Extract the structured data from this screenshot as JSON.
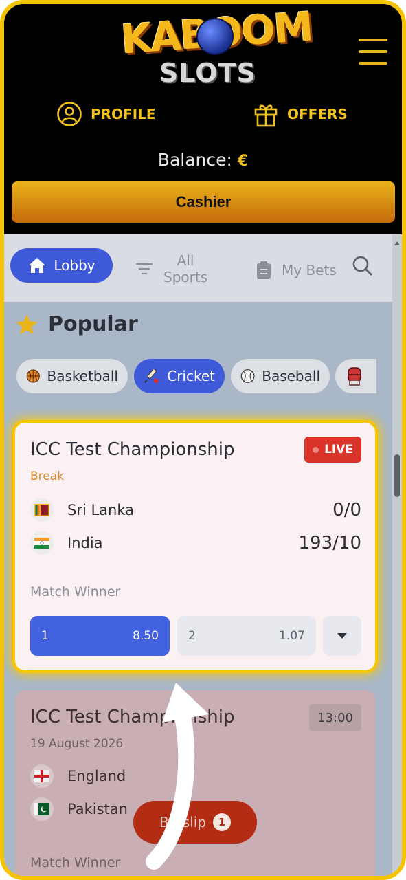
{
  "header": {
    "logo_top": "KABOOM",
    "logo_bottom": "SLOTS",
    "profile_label": "PROFILE",
    "offers_label": "OFFERS",
    "balance_label": "Balance:",
    "balance_currency": "€",
    "cashier_label": "Cashier"
  },
  "tabbar": {
    "lobby_label": "Lobby",
    "all_sports_line1": "All",
    "all_sports_line2": "Sports",
    "my_bets_label": "My Bets"
  },
  "popular": {
    "title": "Popular",
    "chips": [
      {
        "label": "Basketball",
        "icon": "basketball-icon"
      },
      {
        "label": "Cricket",
        "icon": "cricket-icon",
        "active": true
      },
      {
        "label": "Baseball",
        "icon": "baseball-icon"
      },
      {
        "label": "",
        "icon": "boxing-glove-icon"
      }
    ]
  },
  "matches": [
    {
      "competition": "ICC Test Championship",
      "badge": "LIVE",
      "status": "Break",
      "team1": {
        "name": "Sri Lanka",
        "score": "0/0"
      },
      "team2": {
        "name": "India",
        "score": "193/10"
      },
      "market": "Match Winner",
      "odds": [
        {
          "label": "1",
          "value": "8.50",
          "selected": true
        },
        {
          "label": "2",
          "value": "1.07"
        }
      ]
    },
    {
      "competition": "ICC Test Championship",
      "time": "13:00",
      "date": "19 August 2026",
      "team1": {
        "name": "England"
      },
      "team2": {
        "name": "Pakistan"
      },
      "market": "Match Winner"
    }
  ],
  "betslip": {
    "label": "Betslip",
    "count": "1"
  },
  "colors": {
    "accent_blue": "#3f5ad8",
    "brand_gold": "#f5c400",
    "live_red": "#d9332a"
  }
}
